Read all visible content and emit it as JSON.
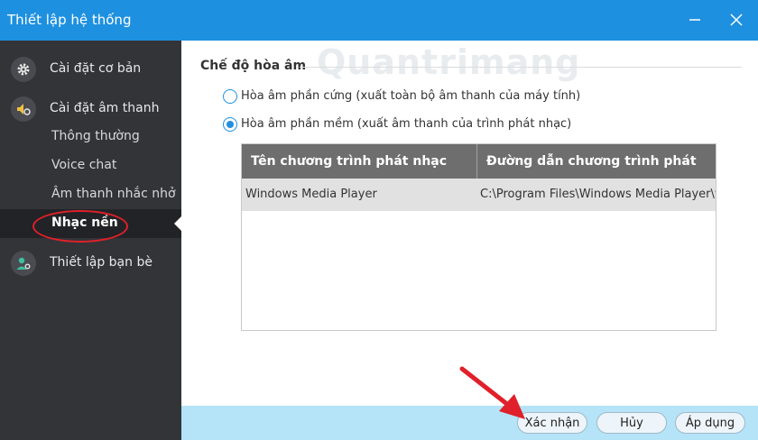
{
  "window": {
    "title": "Thiết lập hệ thống",
    "minimize_icon": "minimize-icon",
    "close_icon": "close-icon"
  },
  "sidebar": {
    "groups": [
      {
        "label": "Cài đặt cơ bản",
        "icon": "gear-icon"
      },
      {
        "label": "Cài đặt âm thanh",
        "icon": "speaker-gear-icon"
      },
      {
        "label": "Thiết lập bạn bè",
        "icon": "user-gear-icon"
      }
    ],
    "sub_items": [
      {
        "label": "Thông thường"
      },
      {
        "label": "Voice chat"
      },
      {
        "label": "Âm thanh nhắc nhở"
      },
      {
        "label": "Nhạc nền",
        "active": true
      }
    ],
    "active_color": "#222326"
  },
  "main": {
    "section_title": "Chế độ hòa âm",
    "watermark": "Quantrimang",
    "radios": [
      {
        "label": "Hòa âm phần cứng (xuất toàn bộ âm thanh của máy tính)",
        "checked": false
      },
      {
        "label": "Hòa âm phần mềm (xuất âm thanh của trình phát nhạc)",
        "checked": true
      }
    ],
    "table": {
      "columns": [
        "Tên chương trình phát nhạc",
        "Đường dẫn chương trình phát nhạc"
      ],
      "rows": [
        [
          "Windows Media Player",
          "C:\\Program Files\\Windows Media Player\\w..."
        ]
      ]
    }
  },
  "footer": {
    "confirm_label": "Xác nhận",
    "cancel_label": "Hủy",
    "apply_label": "Áp dụng"
  },
  "colors": {
    "titlebar": "#1e90e0",
    "sidebar": "#333438",
    "footer": "#b5e3f7",
    "annotation": "#e0202a"
  }
}
